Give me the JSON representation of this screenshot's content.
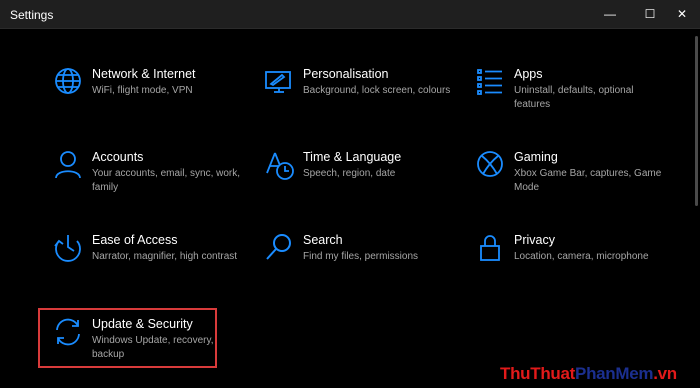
{
  "window": {
    "title": "Settings",
    "minimize": "—",
    "maximize": "☐",
    "close": "✕"
  },
  "tiles": [
    {
      "title": "Network & Internet",
      "desc": "WiFi, flight mode, VPN",
      "icon": "globe-icon"
    },
    {
      "title": "Personalisation",
      "desc": "Background, lock screen, colours",
      "icon": "personalisation-icon"
    },
    {
      "title": "Apps",
      "desc": "Uninstall, defaults, optional features",
      "icon": "apps-list-icon"
    },
    {
      "title": "Accounts",
      "desc": "Your accounts, email, sync, work, family",
      "icon": "person-icon"
    },
    {
      "title": "Time & Language",
      "desc": "Speech, region, date",
      "icon": "time-language-icon"
    },
    {
      "title": "Gaming",
      "desc": "Xbox Game Bar, captures, Game Mode",
      "icon": "xbox-icon"
    },
    {
      "title": "Ease of Access",
      "desc": "Narrator, magnifier, high contrast",
      "icon": "ease-of-access-icon"
    },
    {
      "title": "Search",
      "desc": "Find my files, permissions",
      "icon": "search-icon"
    },
    {
      "title": "Privacy",
      "desc": "Location, camera, microphone",
      "icon": "lock-icon"
    },
    {
      "title": "Update & Security",
      "desc": "Windows Update, recovery, backup",
      "icon": "sync-icon"
    }
  ],
  "watermark": {
    "part1": "ThuThuat",
    "part2": "PhanMem",
    "part3": ".vn"
  },
  "colors": {
    "accent": "#1a8cff",
    "highlight": "#d93b3b",
    "background": "#000000"
  }
}
